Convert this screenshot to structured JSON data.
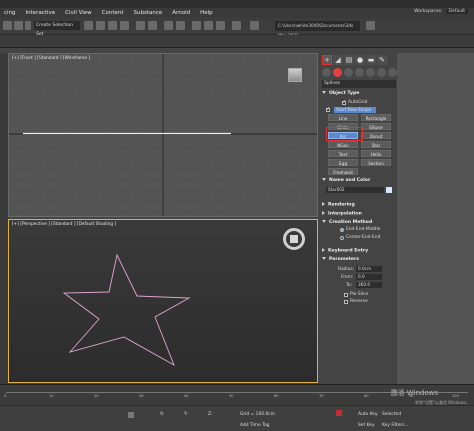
{
  "menu": {
    "items": [
      "cing",
      "Interactive",
      "Civil View",
      "Content",
      "Substance",
      "Arnold",
      "Help"
    ]
  },
  "workspaces": {
    "label": "Workspaces:",
    "value": "Default"
  },
  "toolbar": {
    "selection_set": "Create Selection Set",
    "path": "C:\\Users\\white3040\\Documents\\3ds Max 2021"
  },
  "viewports": {
    "front_label": "[+] [Front ] [Standard ] [Wireframe ]",
    "perspective_label": "[+] [Perspective ] [Standard ] [Default Shading ]"
  },
  "command_panel": {
    "category": "Splines",
    "object_type": {
      "title": "Object Type",
      "autogrid": "AutoGrid",
      "start_new_shape": "Start New Shape",
      "buttons": [
        "Line",
        "Rectangle",
        "Circle",
        "Ellipse",
        "Arc",
        "Donut",
        "NGon",
        "Star",
        "Text",
        "Helix",
        "Egg",
        "Section",
        "Freehand"
      ]
    },
    "name_color": {
      "title": "Name and Color",
      "name": "Star002"
    },
    "rendering": "Rendering",
    "interpolation": "Interpolation",
    "creation_method": {
      "title": "Creation Method",
      "opt1": "End-End-Middle",
      "opt2": "Center-End-End"
    },
    "keyboard_entry": "Keyboard Entry",
    "parameters": {
      "title": "Parameters",
      "radius_label": "Radius:",
      "radius": "0.0cm",
      "from_label": "From:",
      "from": "0.0",
      "to_label": "To:",
      "to": "360.0",
      "pie_slice": "Pie Slice",
      "reverse": "Reverse"
    }
  },
  "timeline": {
    "ticks": [
      "0",
      "10",
      "20",
      "30",
      "40",
      "50",
      "60",
      "70",
      "80",
      "90",
      "100"
    ]
  },
  "status": {
    "grid": "Grid = 100.0cm",
    "add_time_tag": "Add Time Tag",
    "auto_key": "Auto Key",
    "selected": "Selected",
    "set_key": "Set Key",
    "key_filters": "Key Filters..."
  },
  "watermark": {
    "line1": "激活 Windows",
    "line2": "转到\"设置\"以激活 Windows。"
  },
  "colors": {
    "accent": "#e03030",
    "active_button": "#5b89c9",
    "star_shape": "#e6a3d4",
    "viewport_border": "#e0b13a"
  },
  "icons": [
    "plus-icon",
    "modify-icon",
    "hierarchy-icon",
    "motion-icon",
    "display-icon",
    "utilities-icon",
    "navigation-gizmo-icon",
    "viewcube-icon"
  ]
}
